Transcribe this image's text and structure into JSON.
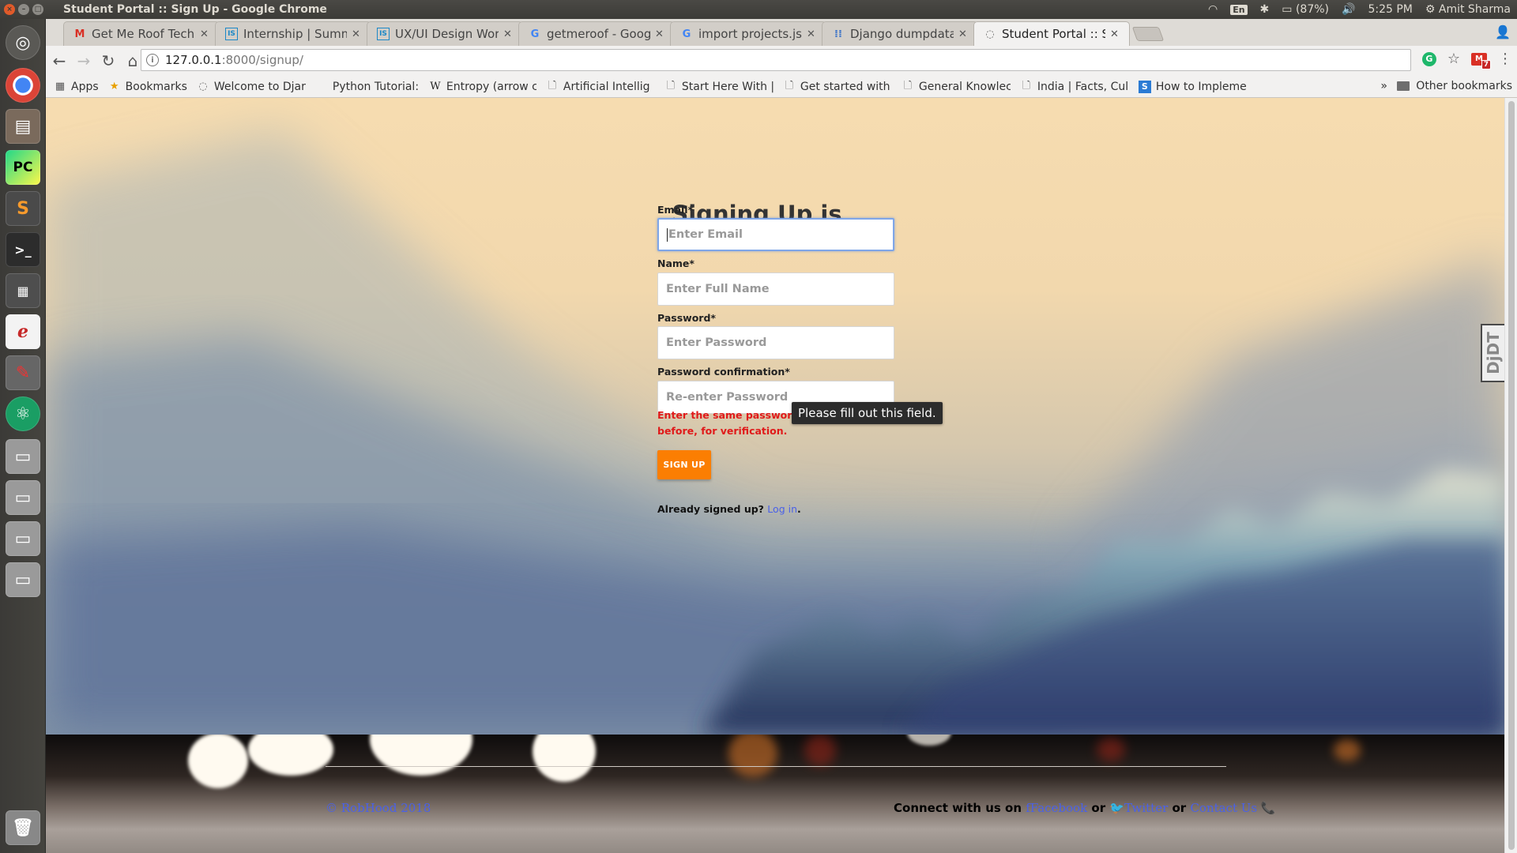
{
  "window": {
    "title": "Student Portal :: Sign Up - Google Chrome"
  },
  "tray": {
    "lang": "En",
    "battery": "(87%)",
    "time": "5:25 PM",
    "user": "Amit Sharma"
  },
  "tabs": [
    {
      "label": "Get Me Roof Tech A",
      "icon": "gmail-icon",
      "glyph": "M",
      "color": "#d93025"
    },
    {
      "label": "Internship | Summe",
      "icon": "internshala-icon",
      "glyph": "IS",
      "color": "#1c88c7"
    },
    {
      "label": "UX/UI Design Work",
      "icon": "internshala-icon",
      "glyph": "IS",
      "color": "#1c88c7"
    },
    {
      "label": "getmeroof - Google",
      "icon": "google-icon",
      "glyph": "G",
      "color": "#4285f4"
    },
    {
      "label": "import projects.jso",
      "icon": "google-icon",
      "glyph": "G",
      "color": "#4285f4"
    },
    {
      "label": "Django dumpdata",
      "icon": "dots-icon",
      "glyph": "⁞⁞",
      "color": "#3b73c8"
    },
    {
      "label": "Student Portal :: Sig",
      "icon": "page-globe-icon",
      "glyph": "◌",
      "color": "#666",
      "active": true
    }
  ],
  "address": {
    "host": "127.0.0.1",
    "path": ":8000/signup/"
  },
  "extensions": {
    "gmail_badge": "7"
  },
  "bookmarks": [
    {
      "label": "Apps",
      "icon": "apps-icon",
      "glyph": "▦",
      "color": "#555"
    },
    {
      "label": "Bookmarks",
      "icon": "star-icon",
      "glyph": "★",
      "color": "#e8a000"
    },
    {
      "label": "Welcome to Djar",
      "icon": "page-globe-icon",
      "glyph": "◌",
      "color": "#666"
    },
    {
      "label": "Python Tutorial:",
      "icon": "python-icon",
      "glyph": " ",
      "color": "#666"
    },
    {
      "label": "Entropy (arrow c",
      "icon": "wikipedia-icon",
      "glyph": "W",
      "color": "#222"
    },
    {
      "label": "Artificial Intellig",
      "icon": "document-icon",
      "glyph": "🗋",
      "color": "#555"
    },
    {
      "label": "Start Here With |",
      "icon": "document-icon",
      "glyph": "🗋",
      "color": "#555"
    },
    {
      "label": "Get started with",
      "icon": "document-icon",
      "glyph": "🗋",
      "color": "#555"
    },
    {
      "label": "General Knowlec",
      "icon": "document-icon",
      "glyph": "🗋",
      "color": "#555"
    },
    {
      "label": "India | Facts, Cul",
      "icon": "document-icon",
      "glyph": "🗋",
      "color": "#555"
    },
    {
      "label": "How to Impleme",
      "icon": "stackshare-icon",
      "glyph": "S",
      "color": "#2b7bd4"
    }
  ],
  "bookmarks_more": "»",
  "other_bookmarks": "Other bookmarks",
  "form": {
    "title": "Signing Up is Free",
    "email_label": "Email*",
    "email_placeholder": "Enter Email",
    "name_label": "Name*",
    "name_placeholder": "Enter Full Name",
    "password_label": "Password*",
    "password_placeholder": "Enter Password",
    "confirm_label": "Password confirmation*",
    "confirm_placeholder": "Re-enter Password",
    "help_text": "Enter the same password as before, for verification.",
    "tooltip": "Please fill out this field.",
    "submit_label": "SIGN UP",
    "login_prompt": "Already signed up?",
    "login_link": "Log in",
    "login_suffix": "."
  },
  "footer": {
    "copyright": "© RobHood 2018",
    "connect_text": "Connect with us on",
    "facebook": "Facebook",
    "or1": "or",
    "twitter": "Twitter",
    "or2": "or",
    "contact": "Contact Us"
  },
  "debug_toolbar": {
    "label": "DjDT"
  },
  "colors": {
    "accent_button": "#fb7e02",
    "error": "#e01a1a",
    "link": "#4a61e8"
  }
}
